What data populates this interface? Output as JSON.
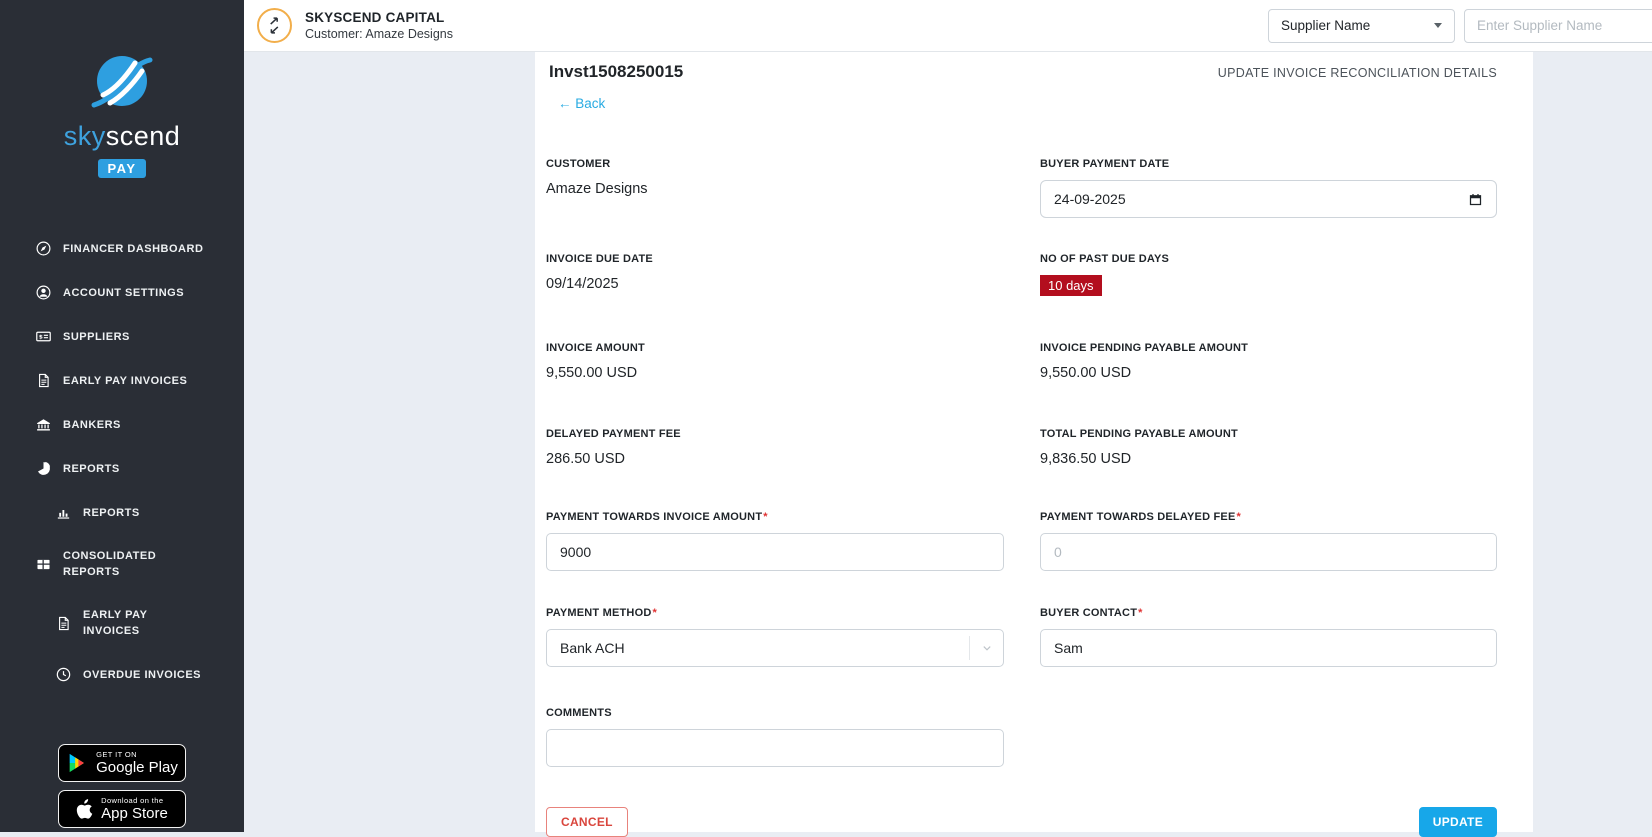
{
  "brand": {
    "name_primary": "sky",
    "name_secondary": "scend",
    "badge": "PAY"
  },
  "header": {
    "company": "SKYSCEND CAPITAL",
    "customer_line": "Customer: Amaze Designs",
    "supplier_filter_value": "Supplier Name",
    "supplier_search_placeholder": "Enter Supplier Name"
  },
  "sidebar": {
    "items": [
      {
        "label": "FINANCER DASHBOARD"
      },
      {
        "label": "ACCOUNT SETTINGS"
      },
      {
        "label": "SUPPLIERS"
      },
      {
        "label": "EARLY PAY INVOICES"
      },
      {
        "label": "BANKERS"
      },
      {
        "label": "REPORTS"
      },
      {
        "label": "REPORTS"
      },
      {
        "label": "CONSOLIDATED REPORTS"
      },
      {
        "label": "EARLY PAY INVOICES"
      },
      {
        "label": "OVERDUE INVOICES"
      }
    ],
    "google_play": {
      "line1": "GET IT ON",
      "line2": "Google Play"
    },
    "app_store": {
      "line1": "Download on the",
      "line2": "App Store"
    }
  },
  "page": {
    "invoice_id": "Invst1508250015",
    "section_title": "UPDATE INVOICE RECONCILIATION DETAILS",
    "back_label": "← Back"
  },
  "form": {
    "customer": {
      "label": "CUSTOMER",
      "value": "Amaze Designs"
    },
    "buyer_payment_date": {
      "label": "BUYER PAYMENT DATE",
      "value": "24-09-2025"
    },
    "invoice_due_date": {
      "label": "INVOICE DUE DATE",
      "value": "09/14/2025"
    },
    "past_due_days": {
      "label": "NO OF PAST DUE DAYS",
      "value": "10 days"
    },
    "invoice_amount": {
      "label": "INVOICE AMOUNT",
      "value": "9,550.00 USD"
    },
    "invoice_pending_payable": {
      "label": "INVOICE PENDING PAYABLE AMOUNT",
      "value": "9,550.00 USD"
    },
    "delayed_payment_fee": {
      "label": "DELAYED PAYMENT FEE",
      "value": "286.50 USD"
    },
    "total_pending_payable": {
      "label": "TOTAL PENDING PAYABLE AMOUNT",
      "value": "9,836.50 USD"
    },
    "payment_towards_invoice": {
      "label": "PAYMENT TOWARDS INVOICE AMOUNT",
      "required": "*",
      "value": "9000"
    },
    "payment_towards_delayed_fee": {
      "label": "PAYMENT TOWARDS DELAYED FEE",
      "required": "*",
      "placeholder": "0"
    },
    "payment_method": {
      "label": "PAYMENT METHOD",
      "required": "*",
      "value": "Bank ACH"
    },
    "buyer_contact": {
      "label": "BUYER CONTACT",
      "required": "*",
      "value": "Sam"
    },
    "comments": {
      "label": "COMMENTS",
      "value": ""
    }
  },
  "actions": {
    "cancel": "CANCEL",
    "update": "UPDATE"
  },
  "colors": {
    "accent_blue": "#17a7e9",
    "logo_blue": "#2e9fe0",
    "sidebar_bg": "#2a2e36",
    "overdue_red": "#b30e1e",
    "cancel_red": "#d9453c",
    "icon_ring_orange": "#f2ae4a",
    "page_bg": "#e9edf3"
  }
}
